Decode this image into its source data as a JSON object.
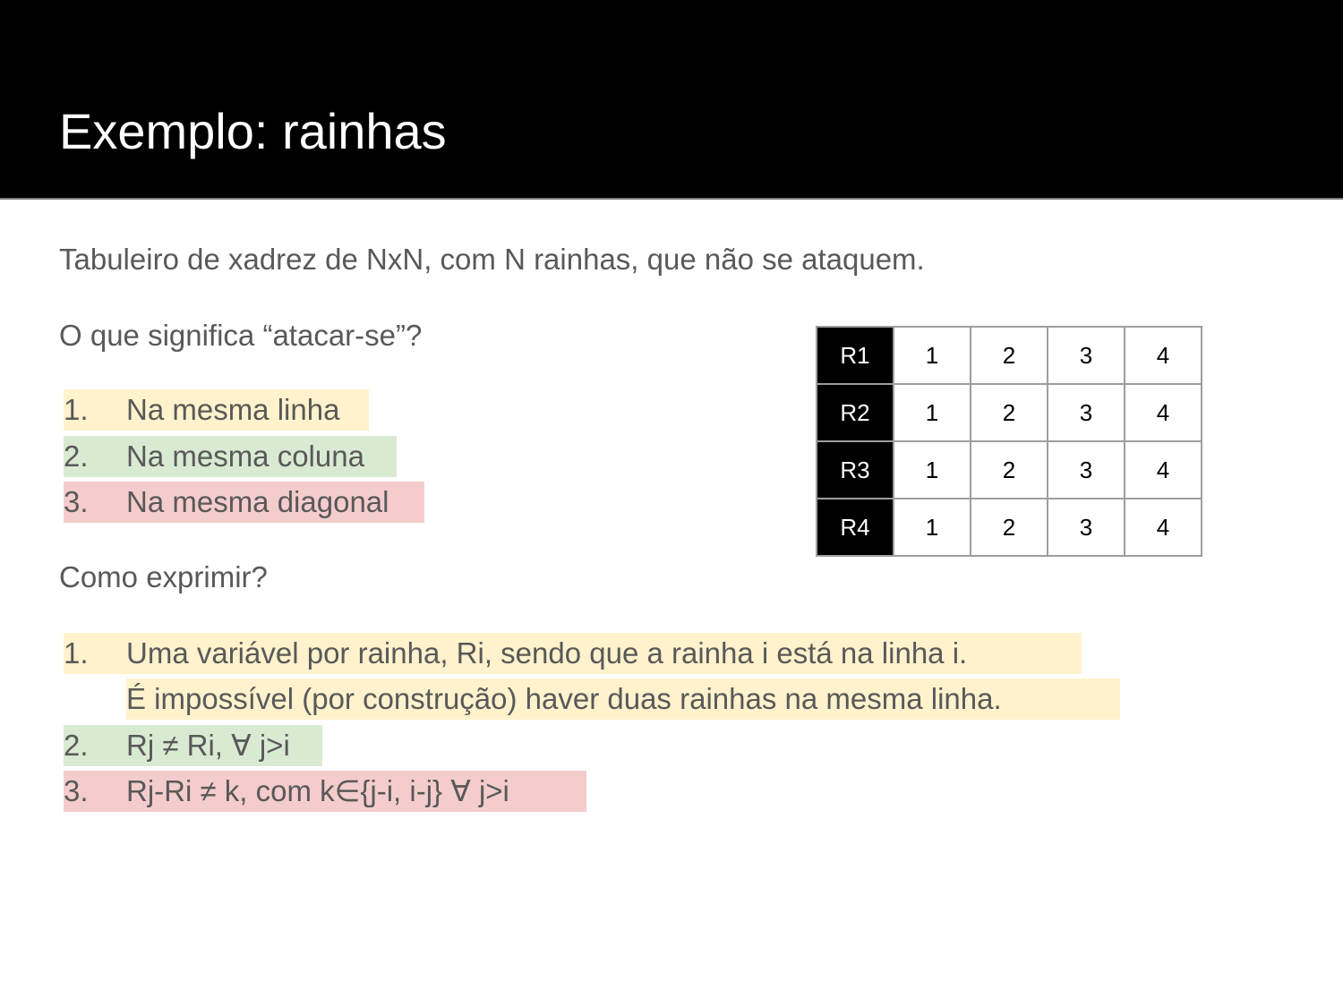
{
  "slide": {
    "title": "Exemplo: rainhas",
    "intro": "Tabuleiro de xadrez de NxN, com N rainhas, que não se ataquem.",
    "question1": "O que significa “atacar-se”?",
    "attack_list": [
      {
        "num": "1.",
        "text": "Na mesma linha",
        "color": "#fff2cc"
      },
      {
        "num": "2.",
        "text": "Na mesma coluna",
        "color": "#d9ead3"
      },
      {
        "num": "3.",
        "text": "Na mesma diagonal",
        "color": "#f4cccc"
      }
    ],
    "question2": "Como exprimir?",
    "express_list": [
      {
        "num": "1.",
        "line1": "Uma variável por rainha, Ri, sendo que a rainha i está na linha i.",
        "line2": "É impossível (por construção) haver duas rainhas na mesma linha.",
        "color": "#fff2cc"
      },
      {
        "num": "2.",
        "text": "Rj ≠ Ri,  ∀ j>i",
        "color": "#d9ead3"
      },
      {
        "num": "3.",
        "text": "Rj-Ri ≠ k, com k∈{j-i, i-j}  ∀ j>i",
        "color": "#f4cccc"
      }
    ]
  },
  "board": {
    "rows": [
      {
        "label": "R1",
        "cells": [
          "1",
          "2",
          "3",
          "4"
        ]
      },
      {
        "label": "R2",
        "cells": [
          "1",
          "2",
          "3",
          "4"
        ]
      },
      {
        "label": "R3",
        "cells": [
          "1",
          "2",
          "3",
          "4"
        ]
      },
      {
        "label": "R4",
        "cells": [
          "1",
          "2",
          "3",
          "4"
        ]
      }
    ]
  }
}
